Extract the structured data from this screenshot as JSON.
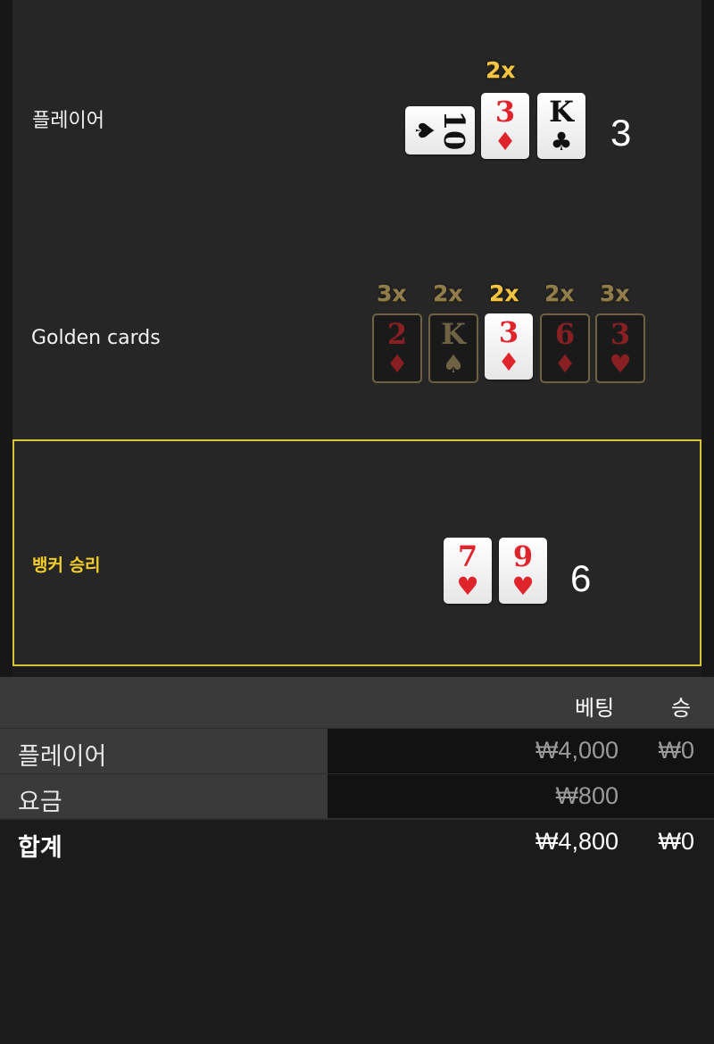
{
  "player": {
    "label": "플레이어",
    "multiplier": "2x",
    "cards": [
      {
        "rank": "10",
        "suit": "♠",
        "color": "black"
      },
      {
        "rank": "3",
        "suit": "♦",
        "color": "red"
      },
      {
        "rank": "K",
        "suit": "♣",
        "color": "black"
      }
    ],
    "total": "3"
  },
  "golden": {
    "label": "Golden cards",
    "cards": [
      {
        "multiplier": "3x",
        "rank": "2",
        "suit": "♦",
        "color": "red",
        "active": false
      },
      {
        "multiplier": "2x",
        "rank": "K",
        "suit": "♠",
        "color": "black",
        "active": false
      },
      {
        "multiplier": "2x",
        "rank": "3",
        "suit": "♦",
        "color": "red",
        "active": true
      },
      {
        "multiplier": "2x",
        "rank": "6",
        "suit": "♦",
        "color": "red",
        "active": false
      },
      {
        "multiplier": "3x",
        "rank": "3",
        "suit": "♥",
        "color": "red",
        "active": false
      }
    ]
  },
  "banker": {
    "label": "뱅커 승리",
    "cards": [
      {
        "rank": "7",
        "suit": "♥",
        "color": "red"
      },
      {
        "rank": "9",
        "suit": "♥",
        "color": "red"
      }
    ],
    "total": "6",
    "highlight_color": "#d8c23a"
  },
  "table": {
    "headers": {
      "bet": "베팅",
      "win": "승"
    },
    "rows": [
      {
        "name": "플레이어",
        "bet": "₩4,000",
        "win": "₩0"
      },
      {
        "name": "요금",
        "bet": "₩800",
        "win": ""
      }
    ],
    "total": {
      "name": "합계",
      "bet": "₩4,800",
      "win": "₩0"
    }
  }
}
